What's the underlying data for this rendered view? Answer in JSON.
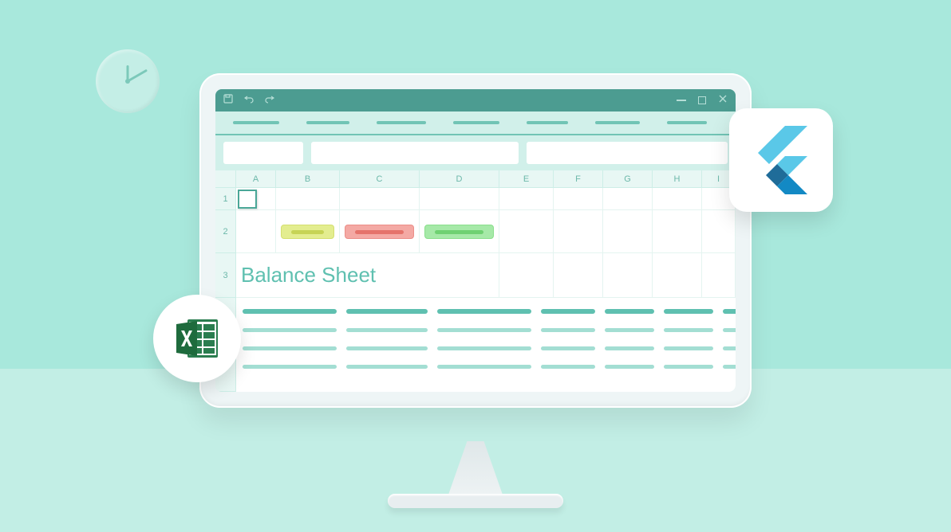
{
  "sheet": {
    "title": "Balance Sheet",
    "columns": [
      "A",
      "B",
      "C",
      "D",
      "E",
      "F",
      "G",
      "H",
      "I"
    ],
    "rows": [
      "1",
      "2",
      "3"
    ],
    "selected_cell": "A1"
  },
  "badges": {
    "excel": "Excel",
    "flutter": "Flutter"
  }
}
